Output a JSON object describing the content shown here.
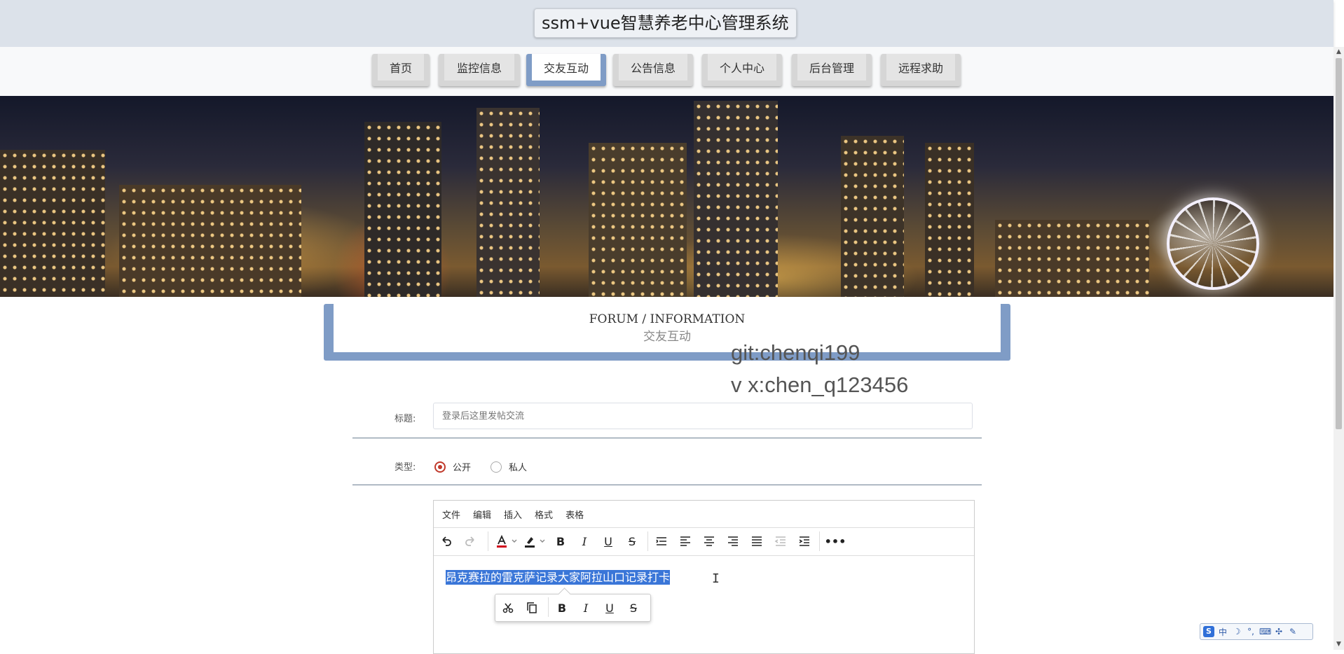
{
  "header": {
    "title": "ssm+vue智慧养老中心管理系统"
  },
  "nav": {
    "items": [
      {
        "label": "首页"
      },
      {
        "label": "监控信息"
      },
      {
        "label": "交友互动",
        "active": true
      },
      {
        "label": "公告信息"
      },
      {
        "label": "个人中心"
      },
      {
        "label": "后台管理"
      },
      {
        "label": "远程求助"
      }
    ]
  },
  "banner": {
    "slide_count": 3,
    "active_slide": 1
  },
  "section": {
    "title_en": "FORUM / INFORMATION",
    "title_cn": "交友互动"
  },
  "watermark": {
    "line1": "git:chenqi199",
    "line2": "v x:chen_q123456"
  },
  "form": {
    "title_label": "标题:",
    "title_placeholder": "登录后这里发帖交流",
    "type_label": "类型:",
    "type_options": [
      {
        "label": "公开",
        "checked": true
      },
      {
        "label": "私人",
        "checked": false
      }
    ]
  },
  "editor": {
    "menu": [
      "文件",
      "编辑",
      "插入",
      "格式",
      "表格"
    ],
    "content_text": "昂克赛拉的雷克萨记录大家阿拉山口记录打卡"
  },
  "ime": {
    "mode": "中"
  },
  "colors": {
    "nav_active": "#7f9cc6",
    "radio_checked": "#c0392b",
    "selection": "#3a76d8",
    "header_bg": "#dce2ea"
  }
}
